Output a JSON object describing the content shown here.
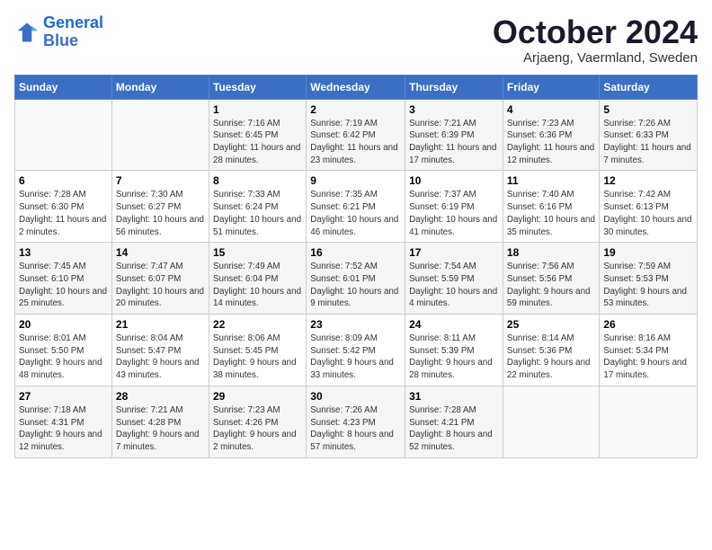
{
  "logo": {
    "line1": "General",
    "line2": "Blue"
  },
  "title": "October 2024",
  "subtitle": "Arjaeng, Vaermland, Sweden",
  "weekdays": [
    "Sunday",
    "Monday",
    "Tuesday",
    "Wednesday",
    "Thursday",
    "Friday",
    "Saturday"
  ],
  "weeks": [
    [
      {
        "day": "",
        "info": ""
      },
      {
        "day": "",
        "info": ""
      },
      {
        "day": "1",
        "info": "Sunrise: 7:16 AM\nSunset: 6:45 PM\nDaylight: 11 hours and 28 minutes."
      },
      {
        "day": "2",
        "info": "Sunrise: 7:19 AM\nSunset: 6:42 PM\nDaylight: 11 hours and 23 minutes."
      },
      {
        "day": "3",
        "info": "Sunrise: 7:21 AM\nSunset: 6:39 PM\nDaylight: 11 hours and 17 minutes."
      },
      {
        "day": "4",
        "info": "Sunrise: 7:23 AM\nSunset: 6:36 PM\nDaylight: 11 hours and 12 minutes."
      },
      {
        "day": "5",
        "info": "Sunrise: 7:26 AM\nSunset: 6:33 PM\nDaylight: 11 hours and 7 minutes."
      }
    ],
    [
      {
        "day": "6",
        "info": "Sunrise: 7:28 AM\nSunset: 6:30 PM\nDaylight: 11 hours and 2 minutes."
      },
      {
        "day": "7",
        "info": "Sunrise: 7:30 AM\nSunset: 6:27 PM\nDaylight: 10 hours and 56 minutes."
      },
      {
        "day": "8",
        "info": "Sunrise: 7:33 AM\nSunset: 6:24 PM\nDaylight: 10 hours and 51 minutes."
      },
      {
        "day": "9",
        "info": "Sunrise: 7:35 AM\nSunset: 6:21 PM\nDaylight: 10 hours and 46 minutes."
      },
      {
        "day": "10",
        "info": "Sunrise: 7:37 AM\nSunset: 6:19 PM\nDaylight: 10 hours and 41 minutes."
      },
      {
        "day": "11",
        "info": "Sunrise: 7:40 AM\nSunset: 6:16 PM\nDaylight: 10 hours and 35 minutes."
      },
      {
        "day": "12",
        "info": "Sunrise: 7:42 AM\nSunset: 6:13 PM\nDaylight: 10 hours and 30 minutes."
      }
    ],
    [
      {
        "day": "13",
        "info": "Sunrise: 7:45 AM\nSunset: 6:10 PM\nDaylight: 10 hours and 25 minutes."
      },
      {
        "day": "14",
        "info": "Sunrise: 7:47 AM\nSunset: 6:07 PM\nDaylight: 10 hours and 20 minutes."
      },
      {
        "day": "15",
        "info": "Sunrise: 7:49 AM\nSunset: 6:04 PM\nDaylight: 10 hours and 14 minutes."
      },
      {
        "day": "16",
        "info": "Sunrise: 7:52 AM\nSunset: 6:01 PM\nDaylight: 10 hours and 9 minutes."
      },
      {
        "day": "17",
        "info": "Sunrise: 7:54 AM\nSunset: 5:59 PM\nDaylight: 10 hours and 4 minutes."
      },
      {
        "day": "18",
        "info": "Sunrise: 7:56 AM\nSunset: 5:56 PM\nDaylight: 9 hours and 59 minutes."
      },
      {
        "day": "19",
        "info": "Sunrise: 7:59 AM\nSunset: 5:53 PM\nDaylight: 9 hours and 53 minutes."
      }
    ],
    [
      {
        "day": "20",
        "info": "Sunrise: 8:01 AM\nSunset: 5:50 PM\nDaylight: 9 hours and 48 minutes."
      },
      {
        "day": "21",
        "info": "Sunrise: 8:04 AM\nSunset: 5:47 PM\nDaylight: 9 hours and 43 minutes."
      },
      {
        "day": "22",
        "info": "Sunrise: 8:06 AM\nSunset: 5:45 PM\nDaylight: 9 hours and 38 minutes."
      },
      {
        "day": "23",
        "info": "Sunrise: 8:09 AM\nSunset: 5:42 PM\nDaylight: 9 hours and 33 minutes."
      },
      {
        "day": "24",
        "info": "Sunrise: 8:11 AM\nSunset: 5:39 PM\nDaylight: 9 hours and 28 minutes."
      },
      {
        "day": "25",
        "info": "Sunrise: 8:14 AM\nSunset: 5:36 PM\nDaylight: 9 hours and 22 minutes."
      },
      {
        "day": "26",
        "info": "Sunrise: 8:16 AM\nSunset: 5:34 PM\nDaylight: 9 hours and 17 minutes."
      }
    ],
    [
      {
        "day": "27",
        "info": "Sunrise: 7:18 AM\nSunset: 4:31 PM\nDaylight: 9 hours and 12 minutes."
      },
      {
        "day": "28",
        "info": "Sunrise: 7:21 AM\nSunset: 4:28 PM\nDaylight: 9 hours and 7 minutes."
      },
      {
        "day": "29",
        "info": "Sunrise: 7:23 AM\nSunset: 4:26 PM\nDaylight: 9 hours and 2 minutes."
      },
      {
        "day": "30",
        "info": "Sunrise: 7:26 AM\nSunset: 4:23 PM\nDaylight: 8 hours and 57 minutes."
      },
      {
        "day": "31",
        "info": "Sunrise: 7:28 AM\nSunset: 4:21 PM\nDaylight: 8 hours and 52 minutes."
      },
      {
        "day": "",
        "info": ""
      },
      {
        "day": "",
        "info": ""
      }
    ]
  ]
}
